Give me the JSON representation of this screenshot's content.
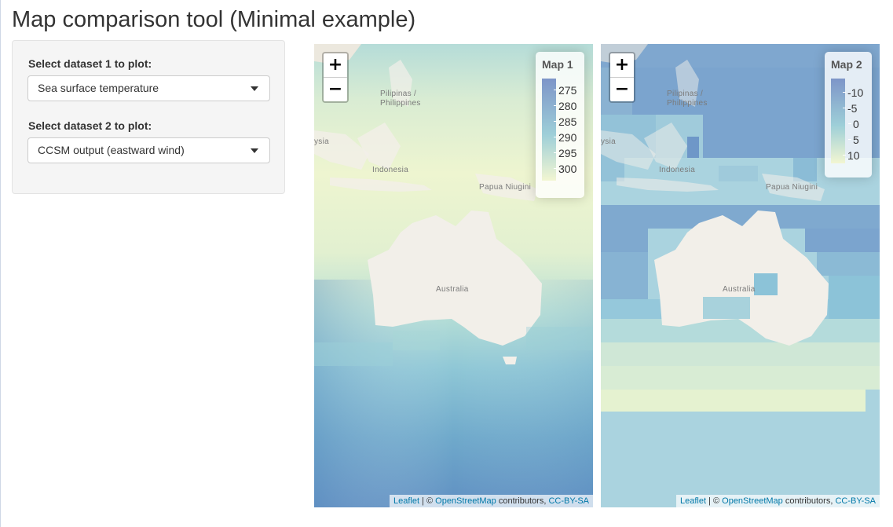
{
  "app_title": "Map comparison tool (Minimal example)",
  "sidebar": {
    "dataset1_label": "Select dataset 1 to plot:",
    "dataset1_value": "Sea surface temperature",
    "dataset2_label": "Select dataset 2 to plot:",
    "dataset2_value": "CCSM output (eastward wind)"
  },
  "zoom": {
    "in": "+",
    "out": "−"
  },
  "map1": {
    "legend_title": "Map 1",
    "legend_ticks": [
      "275",
      "280",
      "285",
      "290",
      "295",
      "300"
    ]
  },
  "map2": {
    "legend_title": "Map 2",
    "legend_ticks": [
      "-10",
      "-5",
      "0",
      "5",
      "10"
    ]
  },
  "attribution": {
    "leaflet": "Leaflet",
    "sep": " | © ",
    "osm": "OpenStreetMap",
    "contributors": " contributors, ",
    "license": "CC-BY-SA"
  },
  "places": {
    "philippines_1": "Pilipinas /",
    "philippines_2": "Philippines",
    "indonesia": "Indonesia",
    "png": "Papua Niugini",
    "australia": "Australia",
    "malaysia_frag": "ysia"
  },
  "colors": {
    "low": "#7d95c8",
    "mid": "#9ecfd8",
    "high": "#f2f6d2",
    "land": "#f2efe9",
    "water_base": "#aad3df"
  }
}
